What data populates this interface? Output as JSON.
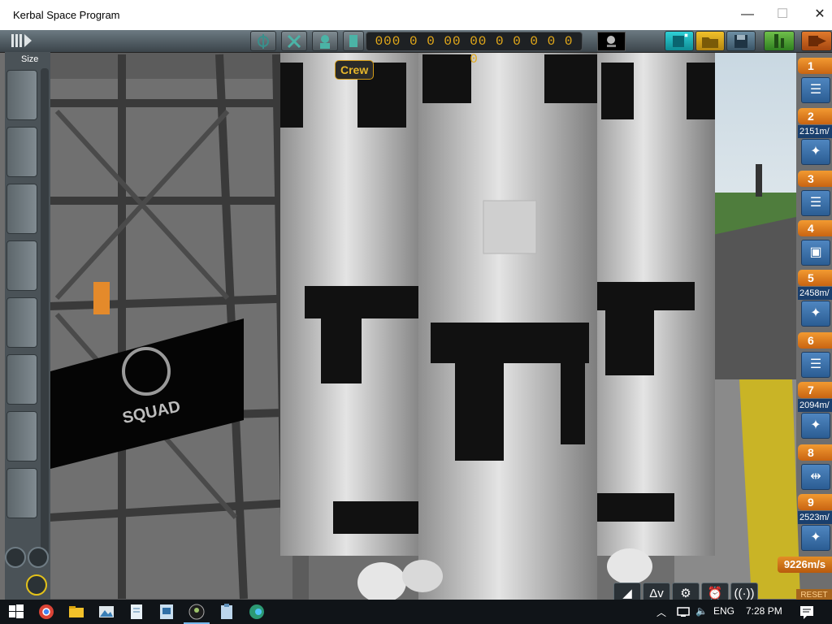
{
  "window": {
    "title": "Kerbal Space Program",
    "minimize": "—",
    "maximize": "☐",
    "close": "✕"
  },
  "toolbar": {
    "funds": "000 0 0 00 00 0  0 0 0 0 0",
    "tooltip": "Crew",
    "accent": "#e3a91a"
  },
  "parts_panel": {
    "size_label": "Size"
  },
  "staging": [
    {
      "stage": "1",
      "dv": ""
    },
    {
      "stage": "2",
      "dv": "2151m/"
    },
    {
      "stage": "3",
      "dv": ""
    },
    {
      "stage": "4",
      "dv": ""
    },
    {
      "stage": "5",
      "dv": "2458m/"
    },
    {
      "stage": "6",
      "dv": ""
    },
    {
      "stage": "7",
      "dv": "2094m/"
    },
    {
      "stage": "8",
      "dv": ""
    },
    {
      "stage": "9",
      "dv": "2523m/"
    }
  ],
  "hud": {
    "total_dv": "9226m/s",
    "reset": "RESET"
  },
  "scene": {
    "sign_text": "SQUAD"
  },
  "taskbar": {
    "language": "ENG",
    "time": "7:28 PM"
  }
}
